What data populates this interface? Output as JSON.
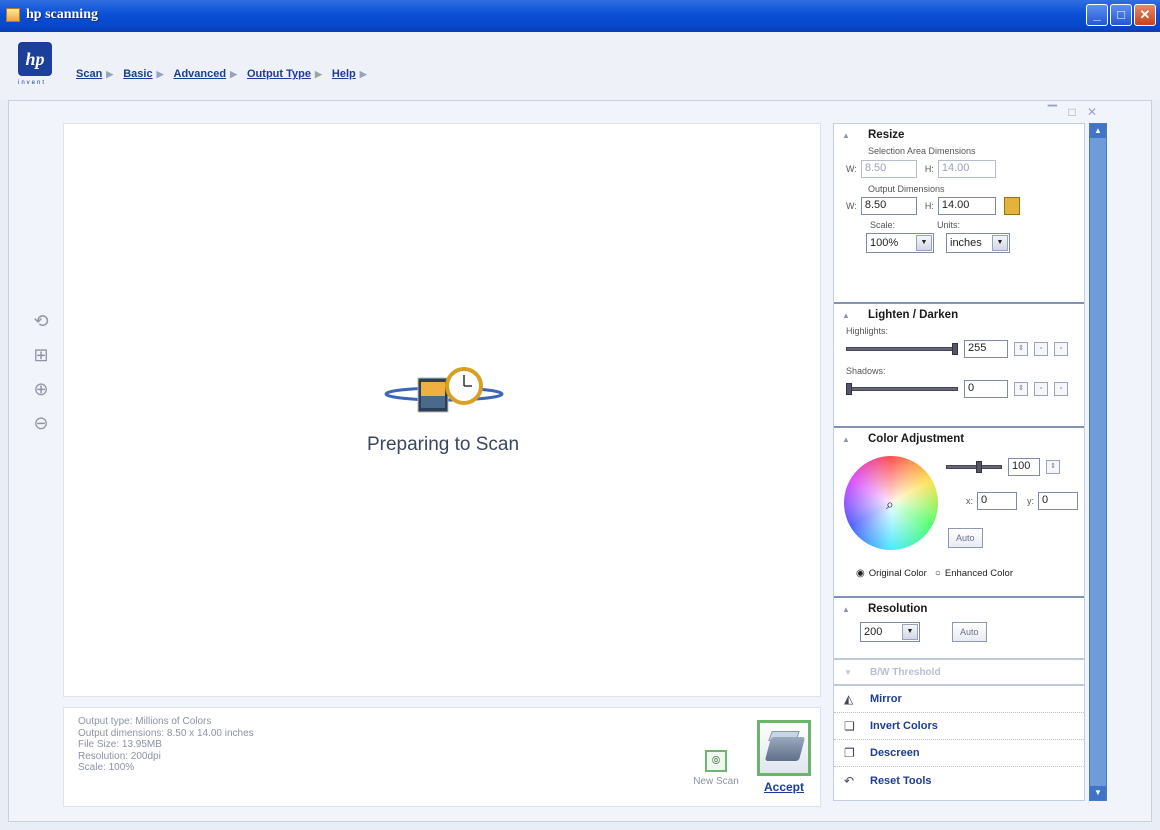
{
  "window": {
    "title": "hp scanning",
    "controls": {
      "minimize": "_",
      "maximize": "□",
      "close": "✕"
    }
  },
  "logo": {
    "mark": "hp",
    "tagline": "invent"
  },
  "menu": [
    {
      "label": "Scan"
    },
    {
      "label": "Basic"
    },
    {
      "label": "Advanced"
    },
    {
      "label": "Output Type"
    },
    {
      "label": "Help"
    }
  ],
  "panel_controls": "▔ □ ✕",
  "preview": {
    "message": "Preparing to Scan"
  },
  "status": {
    "output_type": "Output type: Millions of Colors",
    "output_dimensions": "Output dimensions: 8.50 x 14.00 inches",
    "file_size": "File Size: 13.95MB",
    "resolution": "Resolution: 200dpi",
    "scale": "Scale: 100%"
  },
  "actions": {
    "new_scan": "New Scan",
    "accept": "Accept"
  },
  "resize": {
    "title": "Resize",
    "selection_label": "Selection Area Dimensions",
    "w_label": "W:",
    "h_label": "H:",
    "sel_w": "8.50",
    "sel_h": "14.00",
    "output_label": "Output Dimensions",
    "out_w": "8.50",
    "out_h": "14.00",
    "scale_label": "Scale:",
    "units_label": "Units:",
    "scale_value": "100%",
    "units_value": "inches"
  },
  "lighten_darken": {
    "title": "Lighten / Darken",
    "highlights_label": "Highlights:",
    "highlights_value": "255",
    "highlights_level": 1.0,
    "shadows_label": "Shadows:",
    "shadows_value": "0",
    "shadows_level": 0.0
  },
  "color_adjustment": {
    "title": "Color Adjustment",
    "saturation_value": "100",
    "x_label": "x:",
    "x_value": "0",
    "y_label": "y:",
    "y_value": "0",
    "auto_label": "Auto",
    "original_label": "Original Color",
    "enhanced_label": "Enhanced Color",
    "selected": "Original Color"
  },
  "resolution": {
    "title": "Resolution",
    "value": "200",
    "auto_label": "Auto"
  },
  "bw_threshold": {
    "title": "B/W Threshold"
  },
  "tools": [
    {
      "label": "Mirror",
      "icon": "mirror-icon"
    },
    {
      "label": "Invert Colors",
      "icon": "invert-colors-icon"
    },
    {
      "label": "Descreen",
      "icon": "descreen-icon"
    },
    {
      "label": "Reset Tools",
      "icon": "reset-icon"
    }
  ]
}
